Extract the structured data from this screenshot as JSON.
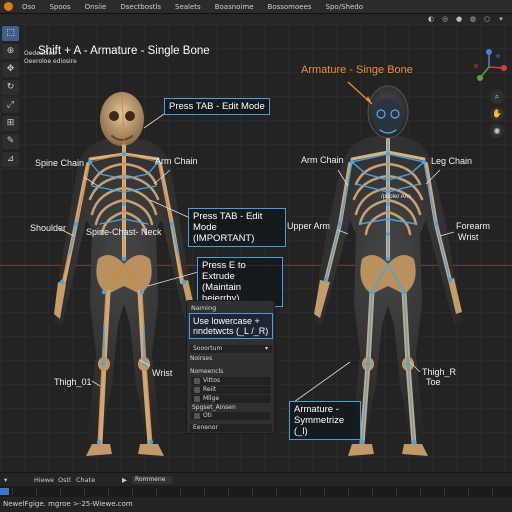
{
  "menu": [
    "Oso",
    "Spoos",
    "Onsiie",
    "Dsectbostls",
    "Sealets",
    "Boasnoime",
    "Bossomoees",
    "Spo/Shedo"
  ],
  "viewport_info": {
    "line1": "Oedeacioe",
    "line2": "Oeeroloe ediosire"
  },
  "headline": "Shift + A - Armature - Single Bone",
  "right_title": "Armature - Singe Bone",
  "labels": {
    "spine_chain": "Spine Chain",
    "arm_chain_left": "Arm Chain",
    "shoulder": "Shoulder",
    "spine_chest_neck": "Spine-Chast- Neck",
    "thigh_l": "Thigh_01",
    "wrist_left": "Wrist",
    "arm_chain_right": "Arm Chain",
    "leg_chain": "Leg Chain",
    "upper_arm": "Upper Arm",
    "forearm": "Forearm",
    "wrist_right": "Wrist",
    "thigh_r": "Thigh_R",
    "toe": "Toe",
    "hand_annot": "/pooler Ans"
  },
  "callouts": {
    "tab_edit": "Press TAB - Edit Mode",
    "tab_edit_important_l1": "Press TAB - Edit Mode",
    "tab_edit_important_l2": "(IMPORTANT)",
    "extrude_l1": "Press E to Extrude",
    "extrude_l2": "(Maintain heierrhy)",
    "symmetrize_l1": "Armature -",
    "symmetrize_l2": "Symmetrize (_l)"
  },
  "panel": {
    "title": "Naming",
    "callout_l1": "Use lowercase +",
    "callout_l2": "nndetwcts (_L /_R)",
    "spectrum": "Sooortum",
    "section": "Noirses",
    "numbers": "Nomeencls",
    "rows": [
      "Vittos",
      "Reiit",
      "Mllge"
    ],
    "sub": "Spgset_Ainsen",
    "last": "Oti",
    "footer": "Eenenor"
  },
  "timeline": {
    "items": [
      "Hiewe",
      "Ostl",
      "Chate"
    ],
    "frame": "Rommene"
  },
  "progress": 0.018,
  "status": "NewelFgige. mgroe >-25-Wiewe.com",
  "colors": {
    "accent": "#4a9fd8",
    "orange": "#f0902a",
    "bone": "#c8a173",
    "select": "#3f5f8f"
  }
}
